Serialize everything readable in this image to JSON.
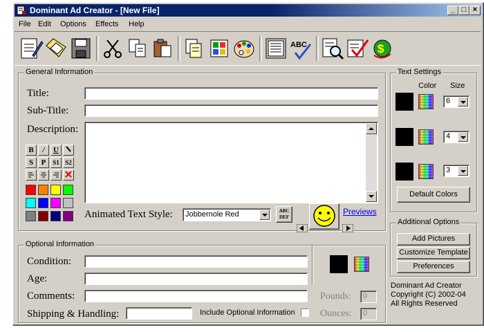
{
  "window": {
    "title": "Dominant Ad Creator - [New File]"
  },
  "menu": {
    "items": [
      "File",
      "Edit",
      "Options",
      "Effects",
      "Help"
    ]
  },
  "general": {
    "legend": "General Information",
    "title_label": "Title:",
    "subtitle_label": "Sub-Title:",
    "description_label": "Description:",
    "title_value": "",
    "subtitle_value": "",
    "description_value": "",
    "animated_label": "Animated Text Style:",
    "animated_value": "Jobbernole Red",
    "previews_link": "Previews",
    "abc_def": "ABC DEF",
    "format_buttons": [
      "B",
      "I",
      "U",
      "S",
      "P",
      "S1",
      "S2"
    ]
  },
  "swatches": [
    "#ff0000",
    "#ff8000",
    "#ffff00",
    "#00ff00",
    "#00ffff",
    "#0000ff",
    "#ff00ff",
    "#c0c0c0",
    "#808080",
    "#800000",
    "#000080",
    "#800080"
  ],
  "text_settings": {
    "legend": "Text Settings",
    "color_header": "Color",
    "size_header": "Size",
    "sizes": [
      "6",
      "4",
      "3"
    ],
    "default_colors_button": "Default Colors"
  },
  "additional": {
    "legend": "Additional Options",
    "add_pictures": "Add Pictures",
    "customize_template": "Customize Template",
    "preferences": "Preferences"
  },
  "optional": {
    "legend": "Optional Information",
    "condition_label": "Condition:",
    "age_label": "Age:",
    "comments_label": "Comments:",
    "shipping_label": "Shipping & Handling:",
    "include_label": "Include Optional Information",
    "pounds_label": "Pounds:",
    "ounces_label": "Ounces:",
    "pounds_value": "0",
    "ounces_value": "0"
  },
  "about": {
    "line1": "Dominant Ad Creator",
    "line2": "Copyright (C) 2002-04",
    "line3": "All Rights Reserved"
  },
  "colors": {
    "titlebar": "#0a246a",
    "face": "#d4d0c8",
    "link": "#0000ee"
  }
}
